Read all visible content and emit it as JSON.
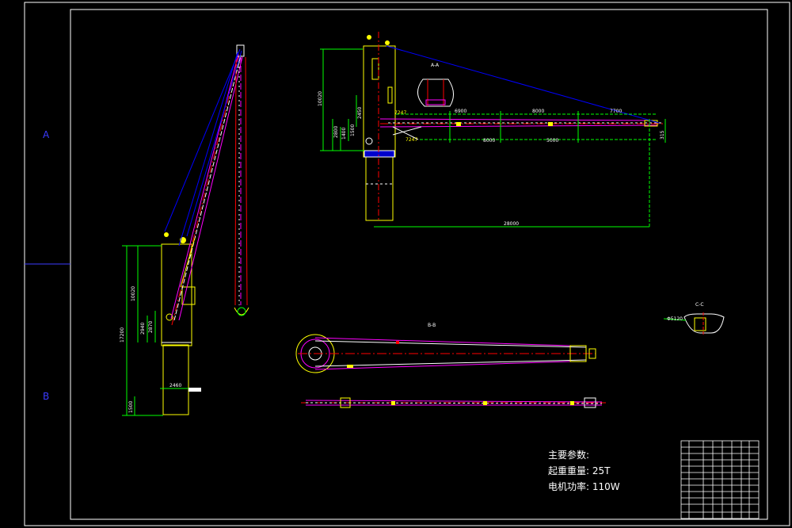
{
  "zone_labels": [
    "A",
    "B"
  ],
  "specs": {
    "title": "主要参数:",
    "line1": "起重重量: 25T",
    "line2": "电机功率: 110W"
  },
  "dimensions": {
    "side_height_total": "17200",
    "side_height_upper": "10020",
    "side_d1": "2940",
    "side_d2": "2870",
    "side_width": "2460",
    "side_base": "1500",
    "top_height": "10020",
    "top_d1": "2800",
    "top_d2": "1400",
    "top_d3": "1500",
    "top_d4": "2450",
    "top_seg1": "6900",
    "top_seg2": "8000",
    "top_seg3": "7700",
    "top_seg4": "8000",
    "top_seg5": "5000",
    "top_total": "28000",
    "top_end": "315",
    "angle1": "7247",
    "angle2": "7247",
    "pipe_dia": "Φ5120"
  },
  "section_labels": {
    "top": "A-A",
    "boom": "B-B",
    "section": "C-C"
  },
  "colors": {
    "frame": "#ffffff",
    "structure": "#ffff00",
    "boom": "#ff0000",
    "rope": "#0000ff",
    "outline": "#ff00ff",
    "dim": "#00ff00",
    "center": "#ff0000"
  }
}
